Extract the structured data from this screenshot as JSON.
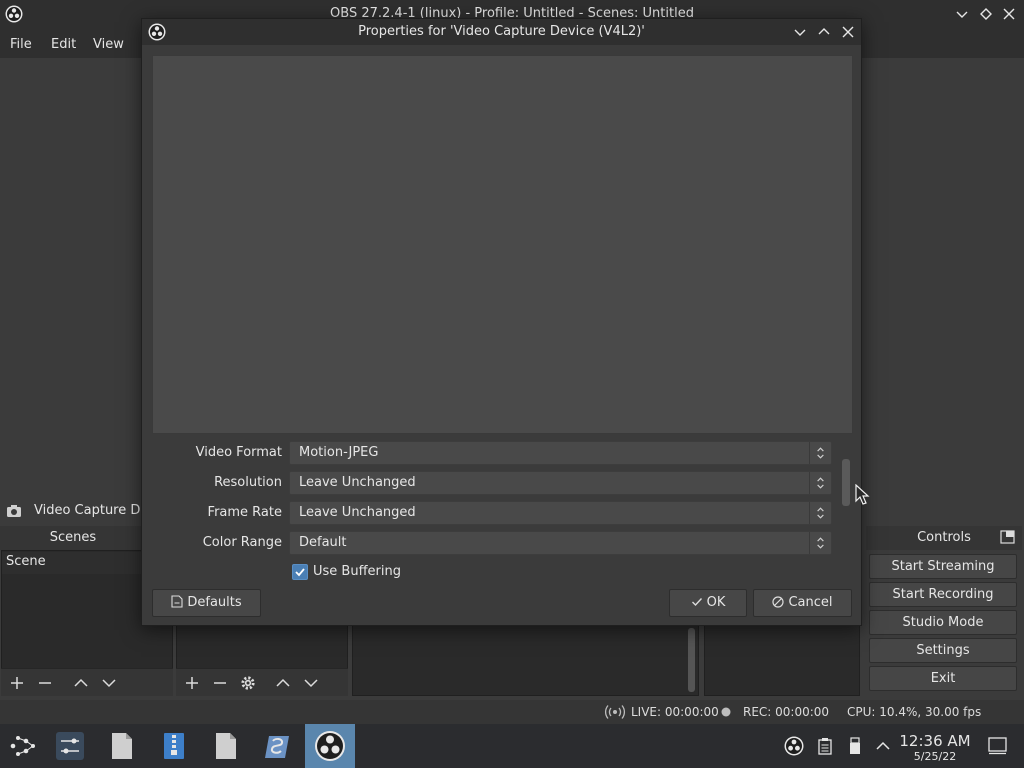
{
  "window": {
    "title": "OBS 27.2.4-1 (linux) - Profile: Untitled - Scenes: Untitled"
  },
  "menu": {
    "items": [
      "File",
      "Edit",
      "View"
    ]
  },
  "sources_bar": {
    "label": "Video Capture Devi"
  },
  "docks": {
    "scenes_header": "Scenes",
    "controls_header": "Controls",
    "scene_items": [
      "Scene"
    ]
  },
  "controls": {
    "buttons": [
      "Start Streaming",
      "Start Recording",
      "Studio Mode",
      "Settings",
      "Exit"
    ]
  },
  "status": {
    "live": "LIVE: 00:00:00",
    "rec": "REC: 00:00:00",
    "cpu": "CPU: 10.4%, 30.00 fps"
  },
  "dialog": {
    "title": "Properties for 'Video Capture Device (V4L2)'",
    "properties": [
      {
        "label": "Video Format",
        "value": "Motion-JPEG"
      },
      {
        "label": "Resolution",
        "value": "Leave Unchanged"
      },
      {
        "label": "Frame Rate",
        "value": "Leave Unchanged"
      },
      {
        "label": "Color Range",
        "value": "Default"
      }
    ],
    "use_buffering": {
      "label": "Use Buffering",
      "checked": true
    },
    "defaults_label": "Defaults",
    "ok_label": "OK",
    "cancel_label": "Cancel"
  },
  "taskbar": {
    "time": "12:36 AM",
    "date": "5/25/22"
  },
  "colors": {
    "accent": "#4a7fb5",
    "taskbar_active": "#5a86ad",
    "panel_bg": "#3b3b3b"
  }
}
